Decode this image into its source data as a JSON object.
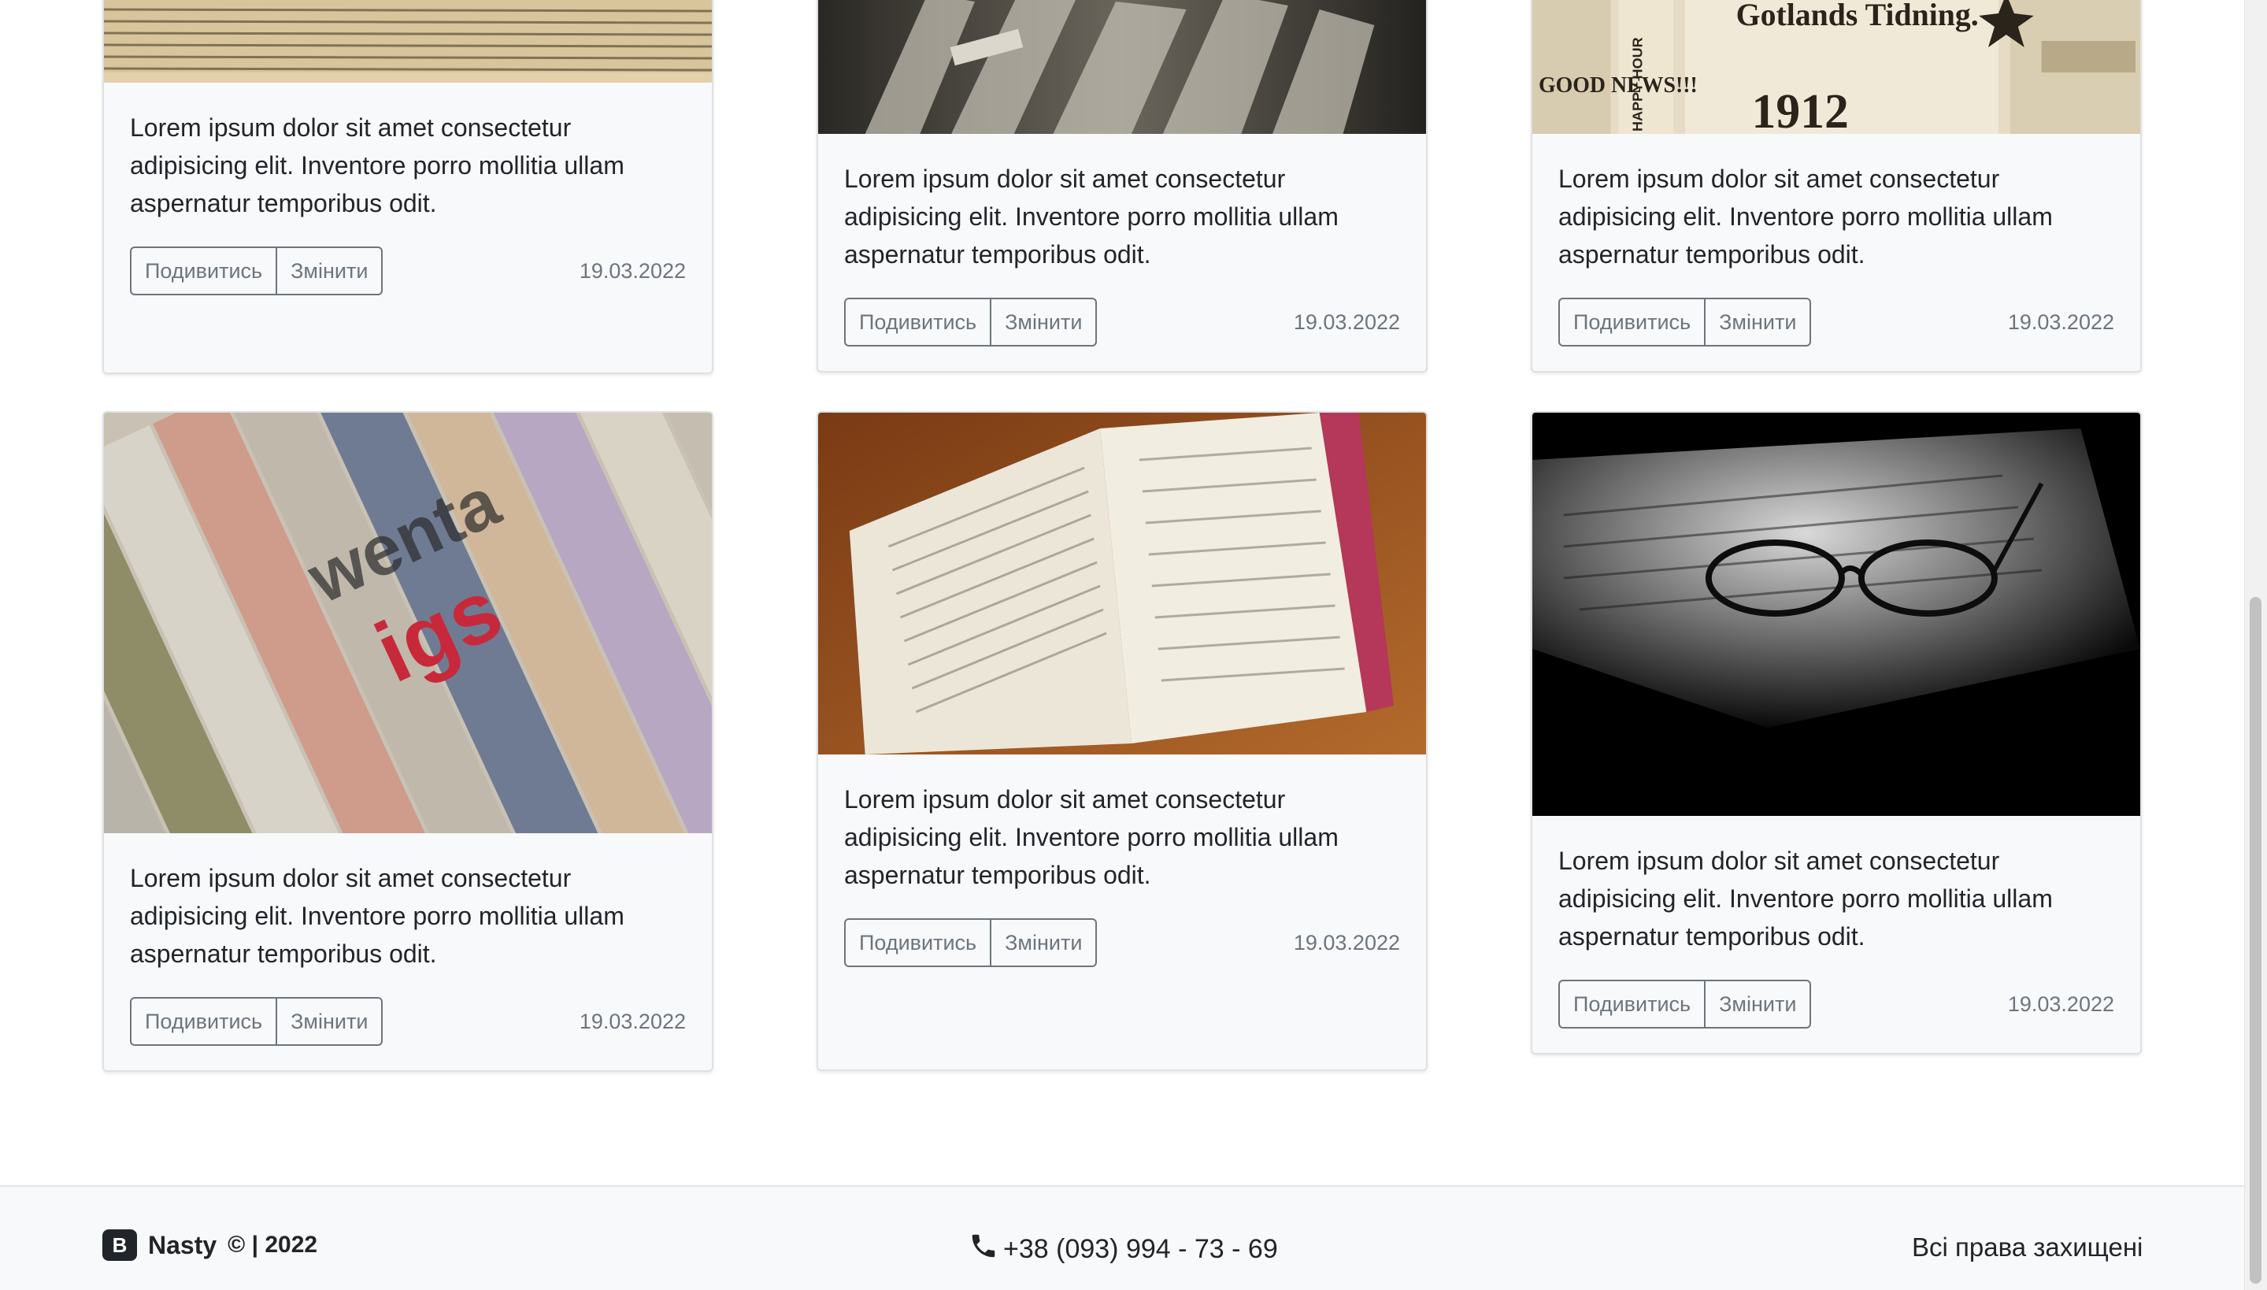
{
  "cards": [
    {
      "text": "Lorem ipsum dolor sit amet consectetur adipisicing elit. Inventore porro mollitia ullam aspernatur temporibus odit.",
      "view_label": "Подивитись",
      "edit_label": "Змінити",
      "date": "19.03.2022",
      "image": "newspaper-text-closeup-image"
    },
    {
      "text": "Lorem ipsum dolor sit amet consectetur adipisicing elit. Inventore porro mollitia ullam aspernatur temporibus odit.",
      "view_label": "Подивитись",
      "edit_label": "Змінити",
      "date": "19.03.2022",
      "image": "newspaper-rack-image"
    },
    {
      "text": "Lorem ipsum dolor sit amet consectetur adipisicing elit. Inventore porro mollitia ullam aspernatur temporibus odit.",
      "view_label": "Подивитись",
      "edit_label": "Змінити",
      "date": "19.03.2022",
      "image": "vintage-newspaper-collage-image",
      "image_text": {
        "masthead": "Gotlands Tidning.",
        "year": "1912",
        "good_news": "GOOD NEWS!!!",
        "happy_hour": "HAPPY HOUR"
      }
    },
    {
      "text": "Lorem ipsum dolor sit amet consectetur adipisicing elit. Inventore porro mollitia ullam aspernatur temporibus odit.",
      "view_label": "Подивитись",
      "edit_label": "Змінити",
      "date": "19.03.2022",
      "image": "rolled-newspapers-image"
    },
    {
      "text": "Lorem ipsum dolor sit amet consectetur adipisicing elit. Inventore porro mollitia ullam aspernatur temporibus odit.",
      "view_label": "Подивитись",
      "edit_label": "Змінити",
      "date": "19.03.2022",
      "image": "open-book-image"
    },
    {
      "text": "Lorem ipsum dolor sit amet consectetur adipisicing elit. Inventore porro mollitia ullam aspernatur temporibus odit.",
      "view_label": "Подивитись",
      "edit_label": "Змінити",
      "date": "19.03.2022",
      "image": "newspaper-with-glasses-image"
    }
  ],
  "footer": {
    "logo_letter": "B",
    "brand": "Nasty",
    "copyright": "© | 2022",
    "phone": "+38 (093) 994 - 73 - 69",
    "phone_icon": "phone-icon",
    "rights": "Всі права захищені"
  },
  "colors": {
    "card_bg": "#f8f9fa",
    "button_outline": "#6c757d",
    "text": "#212529"
  }
}
